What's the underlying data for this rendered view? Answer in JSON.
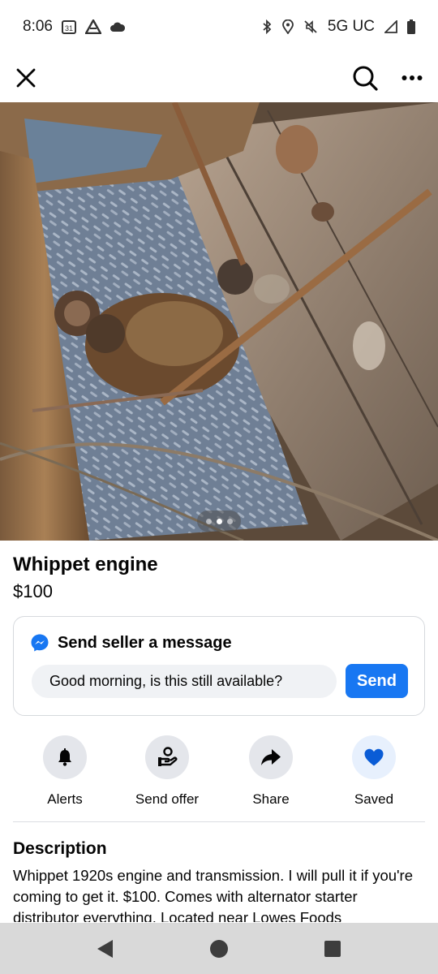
{
  "status_bar": {
    "time": "8:06",
    "calendar_day": "31",
    "network": "5G UC"
  },
  "nav": {
    "close_icon": "close-icon",
    "search_icon": "search-icon",
    "more_icon": "more-icon"
  },
  "photo": {
    "description_icon": "listing-photo",
    "page_count": 3,
    "active_page": 2
  },
  "listing": {
    "title": "Whippet engine",
    "price": "$100"
  },
  "message_card": {
    "heading": "Send seller a message",
    "input_value": "Good morning, is this still available?",
    "send_label": "Send"
  },
  "actions": [
    {
      "label": "Alerts",
      "icon": "bell-icon"
    },
    {
      "label": "Send offer",
      "icon": "offer-icon"
    },
    {
      "label": "Share",
      "icon": "share-icon"
    },
    {
      "label": "Saved",
      "icon": "heart-icon"
    }
  ],
  "description": {
    "heading": "Description",
    "body": "Whippet 1920s engine and transmission. I will pull it if you're coming to get it. $100. Comes with alternator starter distributor everything. Located near Lowes Foods"
  },
  "colors": {
    "accent": "#1877f2",
    "button_bg": "#e4e6eb",
    "input_bg": "#f0f2f5"
  }
}
